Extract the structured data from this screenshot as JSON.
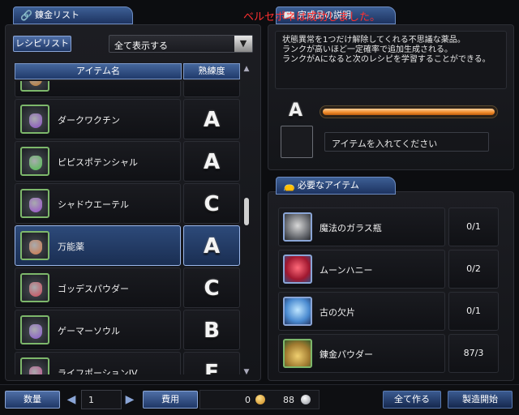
{
  "left_header": {
    "title": "錬金リスト",
    "icon": "flask-icon"
  },
  "recipe_button": "レシピリスト",
  "filter_select": {
    "value": "全て表示する"
  },
  "columns": {
    "item": "アイテム名",
    "mastery": "熟練度"
  },
  "recipes": [
    {
      "name": "",
      "rank": "",
      "color": "#c07a30"
    },
    {
      "name": "ダークワクチン",
      "rank": "A",
      "color": "#8b4fc6"
    },
    {
      "name": "ピピスポテンシャル",
      "rank": "A",
      "color": "#4fc14f"
    },
    {
      "name": "シャドウエーテル",
      "rank": "C",
      "color": "#9b4fd0"
    },
    {
      "name": "万能薬",
      "rank": "A",
      "color": "#d27a4a",
      "selected": true
    },
    {
      "name": "ゴッデスパウダー",
      "rank": "C",
      "color": "#d04a5a"
    },
    {
      "name": "ゲーマーソウル",
      "rank": "B",
      "color": "#8a5ad0"
    },
    {
      "name": "ライフポーションIV",
      "rank": "E",
      "color": "#c04a8a"
    }
  ],
  "system_message": "ベルセポネは成功しました。",
  "desc_header": {
    "title": "完成品の説明",
    "icon": "book-icon"
  },
  "description": [
    "状態異常を1つだけ解除してくれる不思議な薬品。",
    "ランクが高いほど一定確率で追加生成される。",
    "ランクがAになると次のレシピを学習することができる。"
  ],
  "current_rank": "A",
  "progress": 1.0,
  "insert_prompt": "アイテムを入れてください",
  "required_header": {
    "title": "必要なアイテム",
    "icon": "bag-icon"
  },
  "required_items": [
    {
      "name": "魔法のガラス瓶",
      "qty": "0/1",
      "icon": "glass-bottle-icon"
    },
    {
      "name": "ムーンハニー",
      "qty": "0/2",
      "icon": "rose-icon"
    },
    {
      "name": "古の欠片",
      "qty": "0/1",
      "icon": "crystal-icon"
    },
    {
      "name": "錬金パウダー",
      "qty": "87/3",
      "icon": "powder-icon"
    }
  ],
  "bottom": {
    "quantity_label": "数量",
    "quantity_value": "1",
    "cost_label": "費用",
    "gold": "0",
    "points": "88",
    "make_all": "全て作る",
    "start": "製造開始"
  },
  "colors": {
    "accent_blue": "#2a4a80",
    "bar_orange": "#f08a28"
  }
}
